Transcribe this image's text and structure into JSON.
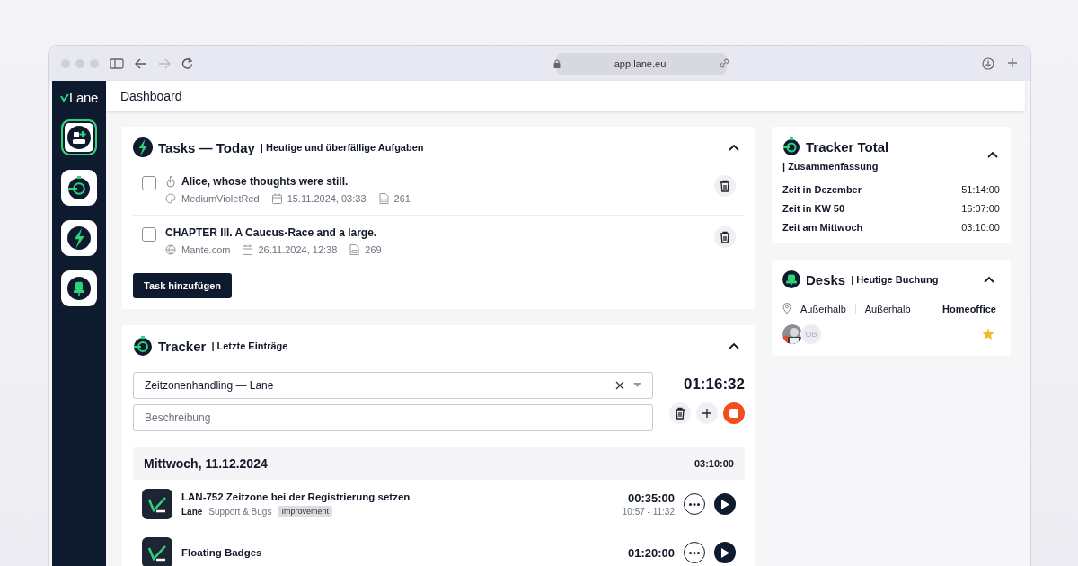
{
  "browser": {
    "url": "app.lane.eu"
  },
  "sidebar": {
    "logo": "Lane",
    "items": [
      {
        "selected": true
      },
      {
        "selected": false
      },
      {
        "selected": false
      },
      {
        "selected": false
      }
    ]
  },
  "header": {
    "title": "Dashboard"
  },
  "tasks": {
    "title": "Tasks — Today",
    "subtitle": "| Heutige und überfällige Aufgaben",
    "expanded": true,
    "items": [
      {
        "title": "Alice, whose thoughts were still.",
        "checked": false,
        "urgent": true,
        "meta": [
          {
            "kind": "palette",
            "text": "MediumVioletRed"
          },
          {
            "kind": "date",
            "text": "15.11.2024, 03:33"
          },
          {
            "kind": "number",
            "text": "261"
          }
        ]
      },
      {
        "title": "CHAPTER III. A Caucus-Race and a large.",
        "checked": false,
        "urgent": false,
        "meta": [
          {
            "kind": "globe",
            "text": "Mante.com"
          },
          {
            "kind": "date",
            "text": "26.11.2024, 12:38"
          },
          {
            "kind": "number",
            "text": "269"
          }
        ]
      }
    ],
    "add_button": "Task hinzufügen"
  },
  "tracker": {
    "title": "Tracker",
    "subtitle": "| Letzte Einträge",
    "expanded": true,
    "project": "Zeitzonenhandling — Lane",
    "description_placeholder": "Beschreibung",
    "timer": "01:16:32",
    "running": true,
    "day": {
      "label": "Mittwoch, 11.12.2024",
      "total": "03:10:00"
    },
    "entries": [
      {
        "title": "LAN-752 Zeitzone bei der Registrierung setzen",
        "project": "Lane",
        "category": "Support & Bugs",
        "tag": "Improvement",
        "duration": "00:35:00",
        "range": "10:57 - 11:32"
      },
      {
        "title": "Floating Badges",
        "duration": "01:20:00"
      }
    ]
  },
  "tracker_total": {
    "title": "Tracker Total",
    "subtitle": "| Zusammenfassung",
    "expanded": true,
    "rows": [
      {
        "label": "Zeit in Dezember",
        "value": "51:14:00"
      },
      {
        "label": "Zeit in KW 50",
        "value": "16:07:00"
      },
      {
        "label": "Zeit am Mittwoch",
        "value": "03:10:00"
      }
    ]
  },
  "desks": {
    "title": "Desks",
    "subtitle": "| Heutige Buchung",
    "expanded": true,
    "locations": [
      "Außerhalb",
      "Außerhalb"
    ],
    "booking": "Homeoffice",
    "favorite": true,
    "people": [
      {
        "kind": "picture"
      },
      {
        "kind": "initials",
        "initials": "OB"
      }
    ]
  }
}
